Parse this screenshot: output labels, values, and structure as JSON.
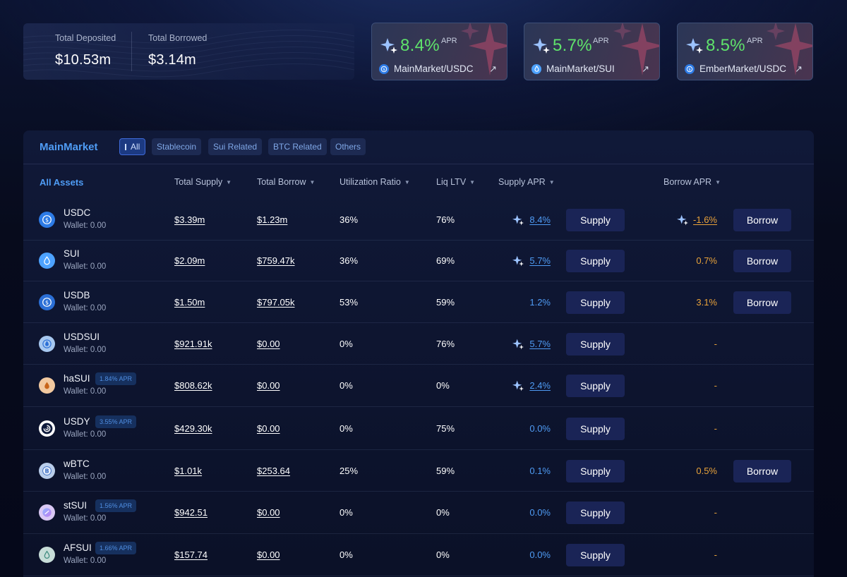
{
  "stats": {
    "total_deposited_label": "Total Deposited",
    "total_deposited_value": "$10.53m",
    "total_borrowed_label": "Total Borrowed",
    "total_borrowed_value": "$3.14m"
  },
  "promos": [
    {
      "apr": "8.4%",
      "apr_label": "APR",
      "market": "MainMarket/USDC",
      "icon": "usdc-coin-icon",
      "coin_color": "#2d7be6"
    },
    {
      "apr": "5.7%",
      "apr_label": "APR",
      "market": "MainMarket/SUI",
      "icon": "sui-coin-icon",
      "coin_color": "#4da2ff"
    },
    {
      "apr": "8.5%",
      "apr_label": "APR",
      "market": "EmberMarket/USDC",
      "icon": "usdc-coin-icon",
      "coin_color": "#2d7be6"
    }
  ],
  "market": {
    "title": "MainMarket",
    "filters": [
      "All",
      "Stablecoin",
      "Sui Related",
      "BTC Related",
      "Others"
    ],
    "active_filter": "All",
    "columns": {
      "assets": "All Assets",
      "total_supply": "Total Supply",
      "total_borrow": "Total Borrow",
      "utilization": "Utilization Ratio",
      "liq_ltv": "Liq LTV",
      "supply_apr": "Supply APR",
      "borrow_apr": "Borrow APR"
    },
    "supply_label": "Supply",
    "borrow_label": "Borrow",
    "assets": [
      {
        "name": "USDC",
        "wallet": "Wallet: 0.00",
        "badge": "",
        "supply": "$3.39m",
        "borrow": "$1.23m",
        "util": "36%",
        "ltv": "76%",
        "supply_apr": "8.4%",
        "supply_boost": true,
        "borrow_apr": "-1.6%",
        "borrow_boost": true,
        "can_borrow": true,
        "icon": "usdc-coin-icon",
        "color": "#2d7be6"
      },
      {
        "name": "SUI",
        "wallet": "Wallet: 0.00",
        "badge": "",
        "supply": "$2.09m",
        "borrow": "$759.47k",
        "util": "36%",
        "ltv": "69%",
        "supply_apr": "5.7%",
        "supply_boost": true,
        "borrow_apr": "0.7%",
        "borrow_boost": false,
        "can_borrow": true,
        "icon": "sui-coin-icon",
        "color": "#4da2ff"
      },
      {
        "name": "USDB",
        "wallet": "Wallet: 0.00",
        "badge": "",
        "supply": "$1.50m",
        "borrow": "$797.05k",
        "util": "53%",
        "ltv": "59%",
        "supply_apr": "1.2%",
        "supply_boost": false,
        "borrow_apr": "3.1%",
        "borrow_boost": false,
        "can_borrow": true,
        "icon": "usdb-coin-icon",
        "color": "#2b6fd6"
      },
      {
        "name": "USDSUI",
        "wallet": "Wallet: 0.00",
        "badge": "",
        "supply": "$921.91k",
        "borrow": "$0.00",
        "util": "0%",
        "ltv": "76%",
        "supply_apr": "5.7%",
        "supply_boost": true,
        "borrow_apr": "-",
        "borrow_boost": false,
        "can_borrow": false,
        "icon": "usdsui-coin-icon",
        "color": "#a7c8f0"
      },
      {
        "name": "haSUI",
        "wallet": "Wallet: 0.00",
        "badge": "1.84% APR",
        "supply": "$808.62k",
        "borrow": "$0.00",
        "util": "0%",
        "ltv": "0%",
        "supply_apr": "2.4%",
        "supply_boost": true,
        "borrow_apr": "-",
        "borrow_boost": false,
        "can_borrow": false,
        "icon": "hasui-coin-icon",
        "color": "#f2c9a0"
      },
      {
        "name": "USDY",
        "wallet": "Wallet: 0.00",
        "badge": "3.55% APR",
        "supply": "$429.30k",
        "borrow": "$0.00",
        "util": "0%",
        "ltv": "75%",
        "supply_apr": "0.0%",
        "supply_boost": false,
        "borrow_apr": "-",
        "borrow_boost": false,
        "can_borrow": false,
        "icon": "usdy-coin-icon",
        "color": "#ffffff"
      },
      {
        "name": "wBTC",
        "wallet": "Wallet: 0.00",
        "badge": "",
        "supply": "$1.01k",
        "borrow": "$253.64",
        "util": "25%",
        "ltv": "59%",
        "supply_apr": "0.1%",
        "supply_boost": false,
        "borrow_apr": "0.5%",
        "borrow_boost": false,
        "can_borrow": true,
        "icon": "wbtc-coin-icon",
        "color": "#b9cdea"
      },
      {
        "name": "stSUI",
        "wallet": "Wallet: 0.00",
        "badge": "1.56% APR",
        "supply": "$942.51",
        "borrow": "$0.00",
        "util": "0%",
        "ltv": "0%",
        "supply_apr": "0.0%",
        "supply_boost": false,
        "borrow_apr": "-",
        "borrow_boost": false,
        "can_borrow": false,
        "icon": "stsui-coin-icon",
        "color": "#d9c8f4"
      },
      {
        "name": "AFSUI",
        "wallet": "Wallet: 0.00",
        "badge": "1.66% APR",
        "supply": "$157.74",
        "borrow": "$0.00",
        "util": "0%",
        "ltv": "0%",
        "supply_apr": "0.0%",
        "supply_boost": false,
        "borrow_apr": "-",
        "borrow_boost": false,
        "can_borrow": false,
        "icon": "afsui-coin-icon",
        "color": "#c7ddd8"
      }
    ]
  }
}
